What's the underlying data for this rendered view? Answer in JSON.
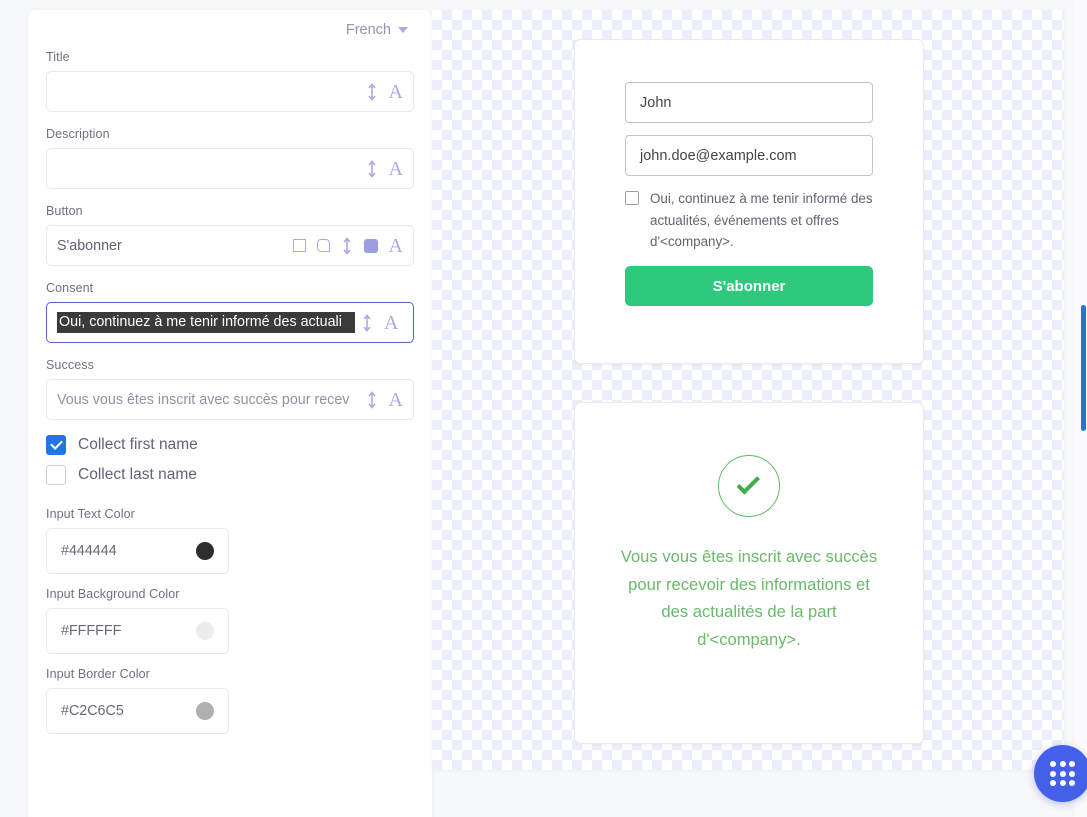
{
  "editor": {
    "language": {
      "selected": "French",
      "icon": "chevron-down-icon"
    },
    "fields": [
      {
        "label": "Title",
        "value": "",
        "icons": [
          "vertical-arrows-icon",
          "typography-icon"
        ]
      },
      {
        "label": "Description",
        "value": "",
        "icons": [
          "vertical-arrows-icon",
          "typography-icon"
        ]
      },
      {
        "label": "Button",
        "value": "S'abonner",
        "icons": [
          "square-outline-icon",
          "rounded-square-icon",
          "vertical-arrows-icon",
          "color-swatch-icon",
          "typography-icon"
        ]
      },
      {
        "label": "Consent",
        "value": "Oui, continuez à me tenir informé des actuali",
        "icons": [
          "vertical-arrows-icon",
          "typography-icon"
        ]
      },
      {
        "label": "Success",
        "value": "Vous vous êtes inscrit avec succès pour recev",
        "icons": [
          "vertical-arrows-icon",
          "typography-icon"
        ]
      }
    ],
    "checkboxes": [
      {
        "label": "Collect first name",
        "checked": true
      },
      {
        "label": "Collect last name",
        "checked": false
      }
    ],
    "colors": [
      {
        "label": "Input Text Color",
        "value": "#444444",
        "swatch": "#2d2d2d"
      },
      {
        "label": "Input Background Color",
        "value": "#FFFFFF",
        "swatch": "#ececec"
      },
      {
        "label": "Input Border Color",
        "value": "#C2C6C5",
        "swatch": "#b0b0b0"
      }
    ],
    "selection_highlight_color": "#3B3B3B",
    "focus_border_color": "#4A68C8"
  },
  "preview": {
    "signup": {
      "first_name_value": "John",
      "email_value": "john.doe@example.com",
      "consent_text": "Oui, continuez à me tenir informé des actualités, événements et offres d'<company>.",
      "consent_checked": false,
      "button_label": "S'abonner",
      "button_color": "#2FC97E",
      "input_text_color": "#444444",
      "input_border_color": "#C2C6C5"
    },
    "success": {
      "icon": "check-circle-icon",
      "message": "Vous vous êtes inscrit avec succès pour recevoir des informations et des actualités de la part d'<company>.",
      "text_color": "#6CB86C",
      "icon_color": "#3EAE4E"
    }
  },
  "fab": {
    "icon": "grid-dots-icon",
    "color": "#4460E8"
  },
  "scrollbar": {
    "thumb_color": "#2F6FD0"
  }
}
